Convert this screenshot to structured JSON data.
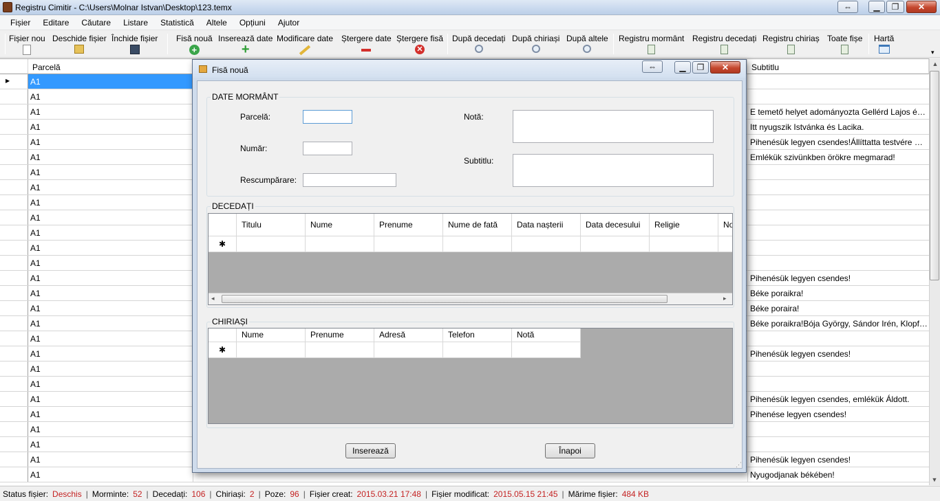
{
  "window": {
    "title": "Registru Cimitir  -  C:\\Users\\Molnar Istvan\\Desktop\\123.temx",
    "controls": {
      "resize": "⇔",
      "minimize": "▁",
      "maximize": "❐",
      "close": "✕"
    }
  },
  "menu": [
    "Fișier",
    "Editare",
    "Căutare",
    "Listare",
    "Statistică",
    "Altele",
    "Opțiuni",
    "Ajutor"
  ],
  "toolbar": [
    {
      "label": "Fișier nou",
      "icon": "new-file-icon"
    },
    {
      "label": "Deschide fișier",
      "icon": "open-file-icon"
    },
    {
      "label": "Închide fișier",
      "icon": "save-disk-icon"
    },
    {
      "label": "Fisă nouă",
      "icon": "add-green-circle-icon"
    },
    {
      "label": "Inserează date",
      "icon": "plus-icon"
    },
    {
      "label": "Modificare date",
      "icon": "pencil-icon"
    },
    {
      "label": "Ștergere date",
      "icon": "minus-icon"
    },
    {
      "label": "Ștergere fisă",
      "icon": "delete-red-icon"
    },
    {
      "label": "După decedați",
      "icon": "magnifier-icon"
    },
    {
      "label": "După chiriași",
      "icon": "magnifier-icon"
    },
    {
      "label": "După altele",
      "icon": "magnifier-icon"
    },
    {
      "label": "Registru mormânt",
      "icon": "register-icon"
    },
    {
      "label": "Registru decedați",
      "icon": "register-icon"
    },
    {
      "label": "Registru chiriaș",
      "icon": "register-icon"
    },
    {
      "label": "Toate fișe",
      "icon": "register-icon"
    },
    {
      "label": "Hartă",
      "icon": "map-icon"
    }
  ],
  "grid": {
    "columns": {
      "parcela": "Parcelă",
      "subtitlu": "Subtitlu"
    },
    "rows": [
      {
        "parcela": "A1",
        "subtitlu": ""
      },
      {
        "parcela": "A1",
        "subtitlu": ""
      },
      {
        "parcela": "A1",
        "subtitlu": "E temető helyet adományozta Gellérd Lajos és neje ..."
      },
      {
        "parcela": "A1",
        "subtitlu": "Itt nyugszik Istvánka és Lacika."
      },
      {
        "parcela": "A1",
        "subtitlu": "Pihenésük legyen csendes!Állíttatta testvére Ferenc."
      },
      {
        "parcela": "A1",
        "subtitlu": "Emlékük szivünkben örökre megmarad!"
      },
      {
        "parcela": "A1",
        "subtitlu": ""
      },
      {
        "parcela": "A1",
        "subtitlu": ""
      },
      {
        "parcela": "A1",
        "subtitlu": ""
      },
      {
        "parcela": "A1",
        "subtitlu": ""
      },
      {
        "parcela": "A1",
        "subtitlu": ""
      },
      {
        "parcela": "A1",
        "subtitlu": ""
      },
      {
        "parcela": "A1",
        "subtitlu": ""
      },
      {
        "parcela": "A1",
        "subtitlu": "Pihenésük legyen csendes!"
      },
      {
        "parcela": "A1",
        "subtitlu": "Béke poraikra!"
      },
      {
        "parcela": "A1",
        "subtitlu": "Béke poraira!"
      },
      {
        "parcela": "A1",
        "subtitlu": "Béke poraikra!Bója György, Sándor Irén, Klopfer Sá..."
      },
      {
        "parcela": "A1",
        "subtitlu": ""
      },
      {
        "parcela": "A1",
        "subtitlu": "Pihenésük legyen csendes!"
      },
      {
        "parcela": "A1",
        "subtitlu": ""
      },
      {
        "parcela": "A1",
        "subtitlu": ""
      },
      {
        "parcela": "A1",
        "subtitlu": "Pihenésük legyen csendes, emlékük Áldott."
      },
      {
        "parcela": "A1",
        "subtitlu": "Pihenése legyen csendes!"
      },
      {
        "parcela": "A1",
        "subtitlu": ""
      },
      {
        "parcela": "A1",
        "subtitlu": ""
      },
      {
        "parcela": "A1",
        "subtitlu": "Pihenésük legyen csendes!"
      },
      {
        "parcela": "A1",
        "subtitlu": "Nyugodjanak békében!"
      }
    ]
  },
  "status": {
    "file_status_label": "Status fișier:",
    "file_status_value": "Deschis",
    "graves_label": "Morminte:",
    "graves_value": "52",
    "deceased_label": "Decedați:",
    "deceased_value": "106",
    "tenants_label": "Chiriași:",
    "tenants_value": "2",
    "photos_label": "Poze:",
    "photos_value": "96",
    "created_label": "Fișier creat:",
    "created_value": "2015.03.21 17:48",
    "modified_label": "Fișier modificat:",
    "modified_value": "2015.05.15 21:45",
    "size_label": "Mărime fișier:",
    "size_value": "484 KB"
  },
  "dialog": {
    "title": "Fisă nouă",
    "grave_group": {
      "legend": "DATE MORMÂNT",
      "parcela_label": "Parcelă:",
      "parcela_value": "",
      "numar_label": "Număr:",
      "numar_value": "",
      "rescumparare_label": "Rescumpărare:",
      "rescumparare_value": "",
      "nota_label": "Notă:",
      "nota_value": "",
      "subtitlu_label": "Subtitlu:",
      "subtitlu_value": ""
    },
    "deceased_group": {
      "legend": "DECEDAȚI",
      "columns": [
        "Titulu",
        "Nume",
        "Prenume",
        "Nume de fată",
        "Data nașterii",
        "Data decesului",
        "Religie",
        "No"
      ],
      "new_row_marker": "✱"
    },
    "tenants_group": {
      "legend": "CHIRIAȘI",
      "columns": [
        "Nume",
        "Prenume",
        "Adresă",
        "Telefon",
        "Notă"
      ],
      "new_row_marker": "✱"
    },
    "insert_button": "Inserează",
    "back_button": "Înapoi"
  },
  "colors": {
    "selection": "#3399ff",
    "status_value": "#c42222",
    "dialog_frame": "#cfdcec"
  }
}
